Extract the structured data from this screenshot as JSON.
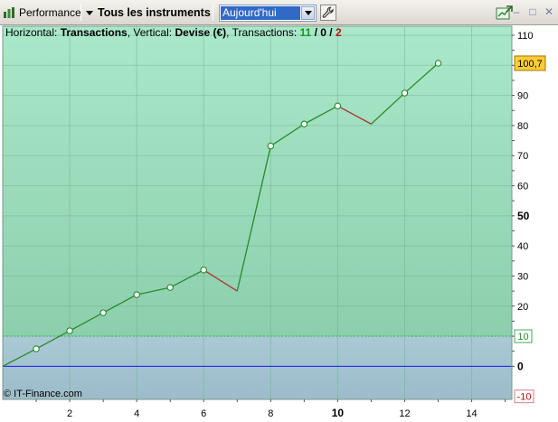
{
  "toolbar": {
    "performance_label": "Performance",
    "instruments_label": "Tous les instruments",
    "period_value": "Aujourd'hui",
    "icons": {
      "performance": "bar-chart-icon",
      "dropdown": "chevron-down-icon",
      "tool": "wrench-icon",
      "export": "export-icon",
      "minimize": "minimize-icon",
      "maximize": "maximize-icon",
      "close": "close-icon"
    }
  },
  "info": {
    "horizontal_label": "Horizontal:",
    "horizontal_value": "Transactions",
    "vertical_label": "Vertical:",
    "vertical_value": "Devise (€)",
    "transactions_label": "Transactions:",
    "count_win": "11",
    "count_even": "0",
    "count_loss": "2",
    "slash": "/"
  },
  "copyright": "© IT-Finance.com",
  "chart_data": {
    "type": "line",
    "x": [
      0,
      1,
      2,
      3,
      4,
      5,
      6,
      7,
      8,
      9,
      10,
      11,
      12,
      13
    ],
    "y": [
      0,
      5.8,
      11.8,
      17.8,
      23.8,
      26.2,
      32,
      25,
      73.2,
      80.5,
      86.5,
      80.5,
      90.8,
      100.7
    ],
    "markers": [
      1,
      2,
      3,
      4,
      5,
      6,
      8,
      9,
      10,
      12,
      13
    ],
    "losing_segments": [
      [
        6,
        7
      ],
      [
        10,
        11
      ]
    ],
    "xlim": [
      0,
      15.2
    ],
    "ylim": [
      -11,
      113
    ],
    "x_ticks": [
      2,
      4,
      6,
      8,
      10,
      12,
      14
    ],
    "x_bold_tick": 10,
    "y_ticks": [
      0,
      10,
      20,
      30,
      40,
      50,
      60,
      70,
      80,
      90,
      100,
      110
    ],
    "y_bold_ticks": [
      0,
      50
    ],
    "y_tag_ticks": [
      100,
      110
    ],
    "last_value_label": "100,7",
    "last_value": 100.7,
    "upper_threshold_label": "10",
    "upper_threshold": 10,
    "lower_threshold_label": "-10",
    "lower_threshold": -10,
    "grid": true,
    "colors": {
      "line": "#2a8a2a",
      "loss": "#b03030",
      "zero_line": "#1a1aff",
      "upper_zone": "#a9e6c6",
      "lower_zone": "#a8c6d2",
      "last_value_bg": "#ffcc33"
    }
  }
}
